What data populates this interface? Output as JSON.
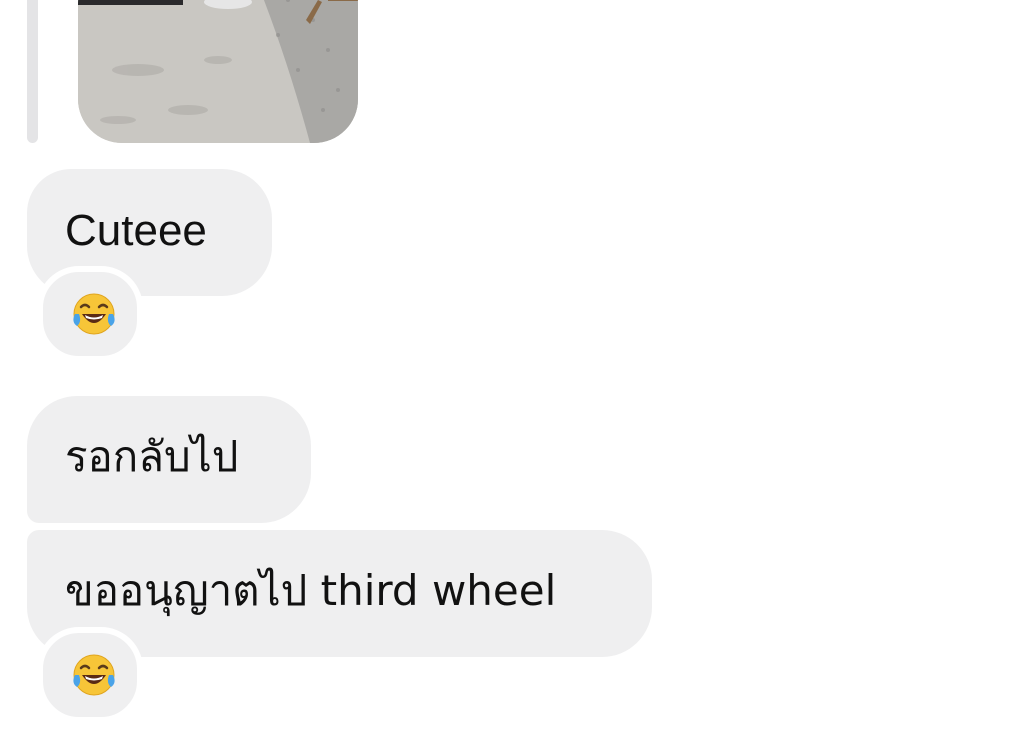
{
  "messages": [
    {
      "text": "Cuteee",
      "reaction": "face-with-tears-of-joy-icon"
    },
    {
      "text": "รอกลับไป"
    },
    {
      "text": "ขออนุญาตไป third wheel",
      "reaction": "face-with-tears-of-joy-icon"
    }
  ],
  "colors": {
    "bubble": "#efeff0",
    "reply_line": "#e4e4e6",
    "text": "#111111",
    "background": "#ffffff"
  }
}
